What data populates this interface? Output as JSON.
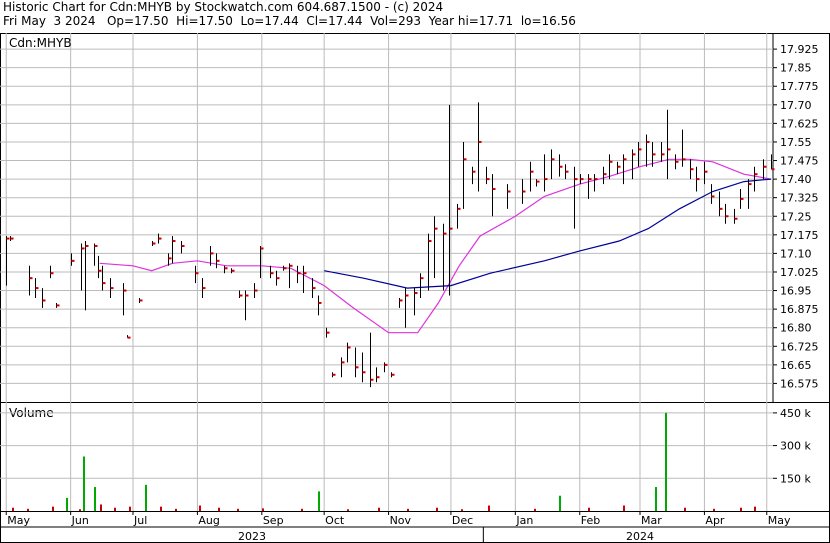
{
  "header": {
    "line1": "Historic Chart for Cdn:MHYB by Stockwatch.com 604.687.1500 - (c) 2024",
    "line2": "Fri May  3 2024   Op=17.50  Hi=17.50  Lo=17.44  Cl=17.44  Vol=293  Year hi=17.71  lo=16.56"
  },
  "chart_data": [
    {
      "type": "ohlc",
      "title": "Cdn:MHYB",
      "ylim": [
        16.5,
        17.99
      ],
      "yticks": [
        "17.925",
        "17.85",
        "17.775",
        "17.70",
        "17.625",
        "17.55",
        "17.475",
        "17.40",
        "17.325",
        "17.25",
        "17.175",
        "17.10",
        "17.025",
        "16.95",
        "16.875",
        "16.80",
        "16.725",
        "16.65",
        "16.575"
      ],
      "x_months": [
        "May",
        "Jun",
        "Jul",
        "Aug",
        "Sep",
        "Oct",
        "Nov",
        "Dec",
        "Jan",
        "Feb",
        "Mar",
        "Apr",
        "May"
      ],
      "x_years": [
        "2023",
        "2024"
      ],
      "bars": [
        {
          "d": "2023-05-01",
          "h": 17.17,
          "l": 16.97,
          "c": 17.16
        },
        {
          "d": "2023-05-03",
          "h": 17.17,
          "l": 17.15,
          "c": 17.16
        },
        {
          "d": "2023-05-12",
          "h": 17.05,
          "l": 16.93,
          "c": 17.0
        },
        {
          "d": "2023-05-15",
          "h": 17.0,
          "l": 16.92,
          "c": 16.96
        },
        {
          "d": "2023-05-18",
          "h": 16.96,
          "l": 16.88,
          "c": 16.91
        },
        {
          "d": "2023-05-22",
          "h": 17.05,
          "l": 17.0,
          "c": 17.02
        },
        {
          "d": "2023-05-25",
          "h": 16.9,
          "l": 16.88,
          "c": 16.89
        },
        {
          "d": "2023-06-01",
          "h": 17.1,
          "l": 17.05,
          "c": 17.07
        },
        {
          "d": "2023-06-06",
          "h": 17.14,
          "l": 16.95,
          "c": 17.12
        },
        {
          "d": "2023-06-08",
          "h": 17.15,
          "l": 16.87,
          "c": 17.13
        },
        {
          "d": "2023-06-12",
          "h": 17.14,
          "l": 17.05,
          "c": 17.13
        },
        {
          "d": "2023-06-14",
          "h": 17.09,
          "l": 17.0,
          "c": 17.03
        },
        {
          "d": "2023-06-16",
          "h": 17.05,
          "l": 16.95,
          "c": 16.98
        },
        {
          "d": "2023-06-20",
          "h": 17.0,
          "l": 16.92,
          "c": 16.96
        },
        {
          "d": "2023-06-26",
          "h": 16.98,
          "l": 16.85,
          "c": 16.95
        },
        {
          "d": "2023-06-28",
          "h": 16.77,
          "l": 16.76,
          "c": 16.76
        },
        {
          "d": "2023-07-04",
          "h": 16.92,
          "l": 16.9,
          "c": 16.91
        },
        {
          "d": "2023-07-10",
          "h": 17.15,
          "l": 17.13,
          "c": 17.14
        },
        {
          "d": "2023-07-13",
          "h": 17.18,
          "l": 17.14,
          "c": 17.16
        },
        {
          "d": "2023-07-18",
          "h": 17.1,
          "l": 17.05,
          "c": 17.08
        },
        {
          "d": "2023-07-20",
          "h": 17.17,
          "l": 17.06,
          "c": 17.15
        },
        {
          "d": "2023-07-24",
          "h": 17.15,
          "l": 17.1,
          "c": 17.13
        },
        {
          "d": "2023-07-31",
          "h": 17.05,
          "l": 16.98,
          "c": 17.02
        },
        {
          "d": "2023-08-03",
          "h": 17.0,
          "l": 16.92,
          "c": 16.96
        },
        {
          "d": "2023-08-07",
          "h": 17.13,
          "l": 17.05,
          "c": 17.1
        },
        {
          "d": "2023-08-10",
          "h": 17.1,
          "l": 17.04,
          "c": 17.07
        },
        {
          "d": "2023-08-14",
          "h": 17.05,
          "l": 17.02,
          "c": 17.04
        },
        {
          "d": "2023-08-17",
          "h": 17.04,
          "l": 17.02,
          "c": 17.03
        },
        {
          "d": "2023-08-21",
          "h": 16.95,
          "l": 16.92,
          "c": 16.93
        },
        {
          "d": "2023-08-24",
          "h": 16.95,
          "l": 16.83,
          "c": 16.93
        },
        {
          "d": "2023-08-28",
          "h": 16.98,
          "l": 16.92,
          "c": 16.95
        },
        {
          "d": "2023-08-31",
          "h": 17.13,
          "l": 17.0,
          "c": 17.12
        },
        {
          "d": "2023-09-05",
          "h": 17.05,
          "l": 17.0,
          "c": 17.02
        },
        {
          "d": "2023-09-08",
          "h": 17.03,
          "l": 16.97,
          "c": 17.0
        },
        {
          "d": "2023-09-11",
          "h": 17.05,
          "l": 17.03,
          "c": 17.04
        },
        {
          "d": "2023-09-14",
          "h": 17.06,
          "l": 16.96,
          "c": 17.05
        },
        {
          "d": "2023-09-18",
          "h": 17.05,
          "l": 16.98,
          "c": 17.02
        },
        {
          "d": "2023-09-21",
          "h": 17.05,
          "l": 16.94,
          "c": 17.02
        },
        {
          "d": "2023-09-25",
          "h": 17.0,
          "l": 16.92,
          "c": 16.96
        },
        {
          "d": "2023-09-28",
          "h": 16.93,
          "l": 16.85,
          "c": 16.9
        },
        {
          "d": "2023-10-02",
          "h": 16.8,
          "l": 16.76,
          "c": 16.78
        },
        {
          "d": "2023-10-05",
          "h": 16.62,
          "l": 16.6,
          "c": 16.61
        },
        {
          "d": "2023-10-09",
          "h": 16.68,
          "l": 16.6,
          "c": 16.66
        },
        {
          "d": "2023-10-12",
          "h": 16.74,
          "l": 16.66,
          "c": 16.72
        },
        {
          "d": "2023-10-16",
          "h": 16.72,
          "l": 16.6,
          "c": 16.64
        },
        {
          "d": "2023-10-19",
          "h": 16.7,
          "l": 16.58,
          "c": 16.62
        },
        {
          "d": "2023-10-23",
          "h": 16.78,
          "l": 16.56,
          "c": 16.59
        },
        {
          "d": "2023-10-26",
          "h": 16.64,
          "l": 16.58,
          "c": 16.6
        },
        {
          "d": "2023-10-30",
          "h": 16.66,
          "l": 16.62,
          "c": 16.65
        },
        {
          "d": "2023-11-02",
          "h": 16.62,
          "l": 16.6,
          "c": 16.61
        },
        {
          "d": "2023-11-06",
          "h": 16.92,
          "l": 16.88,
          "c": 16.91
        },
        {
          "d": "2023-11-09",
          "h": 16.96,
          "l": 16.8,
          "c": 16.93
        },
        {
          "d": "2023-11-13",
          "h": 16.96,
          "l": 16.85,
          "c": 16.94
        },
        {
          "d": "2023-11-16",
          "h": 17.02,
          "l": 16.92,
          "c": 17.0
        },
        {
          "d": "2023-11-20",
          "h": 17.18,
          "l": 16.95,
          "c": 17.15
        },
        {
          "d": "2023-11-23",
          "h": 17.25,
          "l": 17.0,
          "c": 17.2
        },
        {
          "d": "2023-11-27",
          "h": 17.22,
          "l": 16.95,
          "c": 17.18
        },
        {
          "d": "2023-11-30",
          "h": 17.7,
          "l": 16.93,
          "c": 17.2
        },
        {
          "d": "2023-12-04",
          "h": 17.3,
          "l": 17.2,
          "c": 17.28
        },
        {
          "d": "2023-12-07",
          "h": 17.55,
          "l": 17.28,
          "c": 17.48
        },
        {
          "d": "2023-12-11",
          "h": 17.45,
          "l": 17.38,
          "c": 17.43
        },
        {
          "d": "2023-12-14",
          "h": 17.71,
          "l": 17.35,
          "c": 17.55
        },
        {
          "d": "2023-12-18",
          "h": 17.45,
          "l": 17.38,
          "c": 17.4
        },
        {
          "d": "2023-12-21",
          "h": 17.42,
          "l": 17.25,
          "c": 17.36
        },
        {
          "d": "2023-12-28",
          "h": 17.38,
          "l": 17.28,
          "c": 17.35
        },
        {
          "d": "2024-01-04",
          "h": 17.4,
          "l": 17.3,
          "c": 17.35
        },
        {
          "d": "2024-01-08",
          "h": 17.47,
          "l": 17.35,
          "c": 17.43
        },
        {
          "d": "2024-01-11",
          "h": 17.4,
          "l": 17.37,
          "c": 17.39
        },
        {
          "d": "2024-01-15",
          "h": 17.5,
          "l": 17.35,
          "c": 17.4
        },
        {
          "d": "2024-01-18",
          "h": 17.52,
          "l": 17.4,
          "c": 17.48
        },
        {
          "d": "2024-01-22",
          "h": 17.5,
          "l": 17.41,
          "c": 17.45
        },
        {
          "d": "2024-01-25",
          "h": 17.46,
          "l": 17.4,
          "c": 17.43
        },
        {
          "d": "2024-01-29",
          "h": 17.45,
          "l": 17.2,
          "c": 17.4
        },
        {
          "d": "2024-02-01",
          "h": 17.42,
          "l": 17.38,
          "c": 17.4
        },
        {
          "d": "2024-02-05",
          "h": 17.42,
          "l": 17.32,
          "c": 17.4
        },
        {
          "d": "2024-02-08",
          "h": 17.42,
          "l": 17.35,
          "c": 17.4
        },
        {
          "d": "2024-02-12",
          "h": 17.45,
          "l": 17.38,
          "c": 17.42
        },
        {
          "d": "2024-02-15",
          "h": 17.5,
          "l": 17.4,
          "c": 17.47
        },
        {
          "d": "2024-02-19",
          "h": 17.47,
          "l": 17.42,
          "c": 17.45
        },
        {
          "d": "2024-02-22",
          "h": 17.5,
          "l": 17.38,
          "c": 17.48
        },
        {
          "d": "2024-02-26",
          "h": 17.52,
          "l": 17.4,
          "c": 17.5
        },
        {
          "d": "2024-02-29",
          "h": 17.55,
          "l": 17.45,
          "c": 17.52
        },
        {
          "d": "2024-03-04",
          "h": 17.58,
          "l": 17.45,
          "c": 17.55
        },
        {
          "d": "2024-03-07",
          "h": 17.55,
          "l": 17.45,
          "c": 17.5
        },
        {
          "d": "2024-03-11",
          "h": 17.55,
          "l": 17.47,
          "c": 17.5
        },
        {
          "d": "2024-03-14",
          "h": 17.68,
          "l": 17.4,
          "c": 17.52
        },
        {
          "d": "2024-03-18",
          "h": 17.5,
          "l": 17.44,
          "c": 17.47
        },
        {
          "d": "2024-03-21",
          "h": 17.6,
          "l": 17.45,
          "c": 17.48
        },
        {
          "d": "2024-03-25",
          "h": 17.48,
          "l": 17.4,
          "c": 17.44
        },
        {
          "d": "2024-03-28",
          "h": 17.45,
          "l": 17.35,
          "c": 17.4
        },
        {
          "d": "2024-04-01",
          "h": 17.47,
          "l": 17.38,
          "c": 17.43
        },
        {
          "d": "2024-04-04",
          "h": 17.38,
          "l": 17.3,
          "c": 17.33
        },
        {
          "d": "2024-04-08",
          "h": 17.35,
          "l": 17.25,
          "c": 17.28
        },
        {
          "d": "2024-04-11",
          "h": 17.3,
          "l": 17.22,
          "c": 17.25
        },
        {
          "d": "2024-04-15",
          "h": 17.28,
          "l": 17.22,
          "c": 17.24
        },
        {
          "d": "2024-04-18",
          "h": 17.36,
          "l": 17.28,
          "c": 17.32
        },
        {
          "d": "2024-04-22",
          "h": 17.4,
          "l": 17.28,
          "c": 17.38
        },
        {
          "d": "2024-04-25",
          "h": 17.45,
          "l": 17.35,
          "c": 17.42
        },
        {
          "d": "2024-04-29",
          "h": 17.48,
          "l": 17.4,
          "c": 17.45
        },
        {
          "d": "2024-05-03",
          "h": 17.5,
          "l": 17.44,
          "c": 17.44
        }
      ],
      "ma_short": [
        {
          "d": "2023-06-15",
          "v": 17.06
        },
        {
          "d": "2023-07-01",
          "v": 17.05
        },
        {
          "d": "2023-07-10",
          "v": 17.03
        },
        {
          "d": "2023-07-20",
          "v": 17.06
        },
        {
          "d": "2023-08-01",
          "v": 17.07
        },
        {
          "d": "2023-08-15",
          "v": 17.05
        },
        {
          "d": "2023-09-01",
          "v": 17.05
        },
        {
          "d": "2023-09-15",
          "v": 17.04
        },
        {
          "d": "2023-10-01",
          "v": 16.97
        },
        {
          "d": "2023-10-15",
          "v": 16.88
        },
        {
          "d": "2023-11-01",
          "v": 16.78
        },
        {
          "d": "2023-11-15",
          "v": 16.78
        },
        {
          "d": "2023-11-25",
          "v": 16.9
        },
        {
          "d": "2023-12-05",
          "v": 17.05
        },
        {
          "d": "2023-12-15",
          "v": 17.17
        },
        {
          "d": "2024-01-01",
          "v": 17.25
        },
        {
          "d": "2024-01-15",
          "v": 17.33
        },
        {
          "d": "2024-02-01",
          "v": 17.38
        },
        {
          "d": "2024-02-15",
          "v": 17.41
        },
        {
          "d": "2024-03-01",
          "v": 17.45
        },
        {
          "d": "2024-03-15",
          "v": 17.48
        },
        {
          "d": "2024-03-25",
          "v": 17.48
        },
        {
          "d": "2024-04-05",
          "v": 17.47
        },
        {
          "d": "2024-04-20",
          "v": 17.42
        },
        {
          "d": "2024-05-03",
          "v": 17.4
        }
      ],
      "ma_long": [
        {
          "d": "2023-10-01",
          "v": 17.03
        },
        {
          "d": "2023-10-20",
          "v": 17.0
        },
        {
          "d": "2023-11-10",
          "v": 16.96
        },
        {
          "d": "2023-12-01",
          "v": 16.97
        },
        {
          "d": "2023-12-20",
          "v": 17.02
        },
        {
          "d": "2024-01-15",
          "v": 17.07
        },
        {
          "d": "2024-02-01",
          "v": 17.11
        },
        {
          "d": "2024-02-20",
          "v": 17.15
        },
        {
          "d": "2024-03-05",
          "v": 17.2
        },
        {
          "d": "2024-03-20",
          "v": 17.28
        },
        {
          "d": "2024-04-05",
          "v": 17.35
        },
        {
          "d": "2024-04-20",
          "v": 17.39
        },
        {
          "d": "2024-05-03",
          "v": 17.4
        }
      ],
      "colors": {
        "bar": "#000000",
        "close_tick": "#cc0000",
        "ma_short": "#dd33dd",
        "ma_long": "#000099",
        "grid": "#bbbbbb"
      }
    },
    {
      "type": "bar",
      "title": "Volume",
      "ylim": [
        0,
        500000
      ],
      "yticks": [
        "450 k",
        "300 k",
        "150 k"
      ],
      "bars": [
        {
          "d": "2023-05-04",
          "v": 15000
        },
        {
          "d": "2023-05-11",
          "v": 10000
        },
        {
          "d": "2023-05-23",
          "v": 20000
        },
        {
          "d": "2023-05-30",
          "v": 60000
        },
        {
          "d": "2023-06-05",
          "v": 8000
        },
        {
          "d": "2023-06-07",
          "v": 250000
        },
        {
          "d": "2023-06-12",
          "v": 110000
        },
        {
          "d": "2023-06-15",
          "v": 30000
        },
        {
          "d": "2023-06-22",
          "v": 15000
        },
        {
          "d": "2023-06-29",
          "v": 20000
        },
        {
          "d": "2023-07-07",
          "v": 120000
        },
        {
          "d": "2023-07-14",
          "v": 20000
        },
        {
          "d": "2023-07-21",
          "v": 10000
        },
        {
          "d": "2023-08-02",
          "v": 25000
        },
        {
          "d": "2023-08-11",
          "v": 15000
        },
        {
          "d": "2023-08-20",
          "v": 10000
        },
        {
          "d": "2023-09-01",
          "v": 12000
        },
        {
          "d": "2023-09-20",
          "v": 10000
        },
        {
          "d": "2023-09-28",
          "v": 90000
        },
        {
          "d": "2023-10-12",
          "v": 8000
        },
        {
          "d": "2023-10-27",
          "v": 15000
        },
        {
          "d": "2023-11-10",
          "v": 10000
        },
        {
          "d": "2023-11-24",
          "v": 15000
        },
        {
          "d": "2023-12-06",
          "v": 8000
        },
        {
          "d": "2023-12-19",
          "v": 25000
        },
        {
          "d": "2024-01-10",
          "v": 10000
        },
        {
          "d": "2024-01-22",
          "v": 70000
        },
        {
          "d": "2024-02-05",
          "v": 15000
        },
        {
          "d": "2024-02-22",
          "v": 25000
        },
        {
          "d": "2024-03-08",
          "v": 110000
        },
        {
          "d": "2024-03-13",
          "v": 450000
        },
        {
          "d": "2024-03-22",
          "v": 15000
        },
        {
          "d": "2024-04-05",
          "v": 10000
        },
        {
          "d": "2024-04-18",
          "v": 15000
        },
        {
          "d": "2024-04-25",
          "v": 20000
        }
      ],
      "colors": {
        "bar_up": "#00aa00",
        "bar_down": "#cc0000",
        "grid": "#bbbbbb"
      }
    }
  ]
}
